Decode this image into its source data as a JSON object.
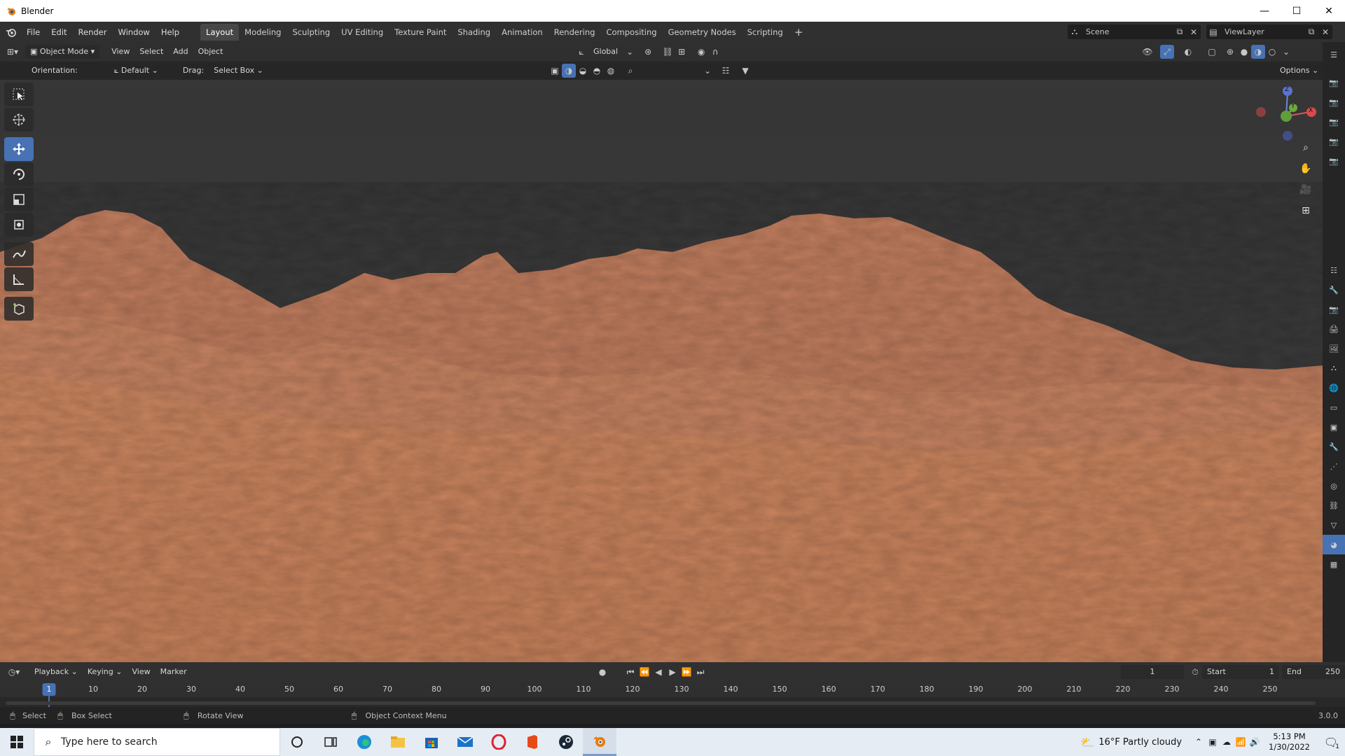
{
  "window": {
    "title": "Blender",
    "minimize": "—",
    "maximize": "☐",
    "close": "✕"
  },
  "menus": [
    "File",
    "Edit",
    "Render",
    "Window",
    "Help"
  ],
  "workspaces": [
    "Layout",
    "Modeling",
    "Sculpting",
    "UV Editing",
    "Texture Paint",
    "Shading",
    "Animation",
    "Rendering",
    "Compositing",
    "Geometry Nodes",
    "Scripting"
  ],
  "active_workspace": "Layout",
  "scene": {
    "label": "Scene",
    "view_layer": "ViewLayer"
  },
  "viewport_header": {
    "mode": "Object Mode",
    "menus": [
      "View",
      "Select",
      "Add",
      "Object"
    ],
    "transform_orientation": "Global",
    "options": "Options"
  },
  "tool_settings": {
    "orientation_label": "Orientation:",
    "orientation_value": "Default",
    "drag_label": "Drag:",
    "drag_value": "Select Box"
  },
  "gizmo": {
    "z": "Z",
    "y": "Y",
    "x": "X"
  },
  "timeline": {
    "menus": [
      "Playback",
      "Keying",
      "View",
      "Marker"
    ],
    "current_frame": "1",
    "start_label": "Start",
    "start_value": "1",
    "end_label": "End",
    "end_value": "250",
    "ticks": [
      "10",
      "20",
      "30",
      "40",
      "50",
      "60",
      "70",
      "80",
      "90",
      "100",
      "110",
      "120",
      "130",
      "140",
      "150",
      "160",
      "170",
      "180",
      "190",
      "200",
      "210",
      "220",
      "230",
      "240",
      "250"
    ],
    "playhead": "1"
  },
  "statusbar": {
    "select": "Select",
    "box_select": "Box Select",
    "rotate_view": "Rotate View",
    "context_menu": "Object Context Menu",
    "version": "3.0.0"
  },
  "taskbar": {
    "search_placeholder": "Type here to search",
    "weather": "16°F  Partly cloudy",
    "time": "5:13 PM",
    "date": "1/30/2022",
    "notification_count": "1"
  },
  "colors": {
    "accent": "#4772b3",
    "terrain": "#c8825f",
    "sky": "#3a3a3a"
  }
}
